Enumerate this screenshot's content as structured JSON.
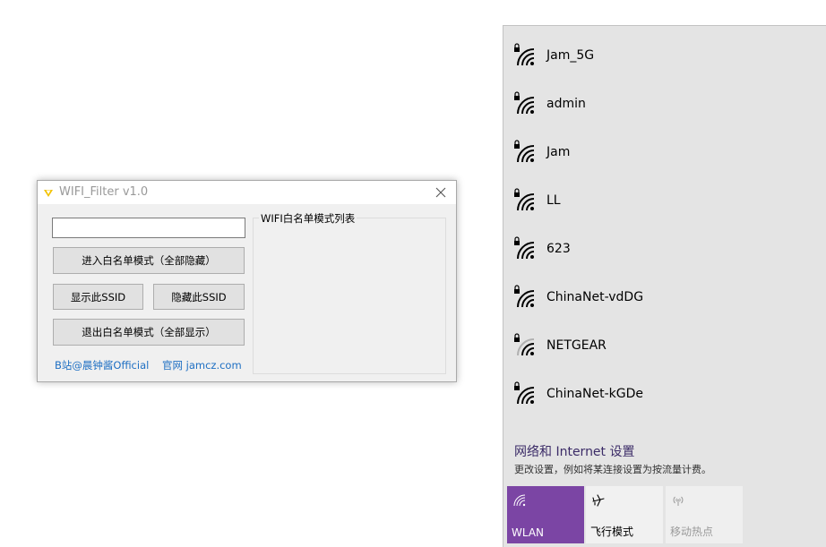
{
  "app": {
    "title": "WIFI_Filter v1.0",
    "input_value": "",
    "buttons": {
      "enter_whitelist": "进入白名单模式（全部隐藏）",
      "show_ssid": "显示此SSID",
      "hide_ssid": "隐藏此SSID",
      "exit_whitelist": "退出白名单模式（全部显示）"
    },
    "links": {
      "bilibili": "B站@晨钟酱Official",
      "website": "官网 jamcz.com"
    },
    "whitelist_group_label": "WIFI白名单模式列表"
  },
  "flyout": {
    "networks": [
      {
        "name": "Jam_5G",
        "secured": true,
        "signal": 4
      },
      {
        "name": "admin",
        "secured": true,
        "signal": 4
      },
      {
        "name": "Jam",
        "secured": true,
        "signal": 4
      },
      {
        "name": "LL",
        "secured": true,
        "signal": 4
      },
      {
        "name": "623",
        "secured": true,
        "signal": 3
      },
      {
        "name": "ChinaNet-vdDG",
        "secured": true,
        "signal": 3
      },
      {
        "name": "NETGEAR",
        "secured": true,
        "signal": 2
      },
      {
        "name": "ChinaNet-kGDe",
        "secured": true,
        "signal": 3
      }
    ],
    "settings": {
      "title": "网络和 Internet 设置",
      "description": "更改设置，例如将某连接设置为按流量计费。"
    },
    "tiles": {
      "wlan": "WLAN",
      "airplane": "飞行模式",
      "hotspot": "移动热点"
    },
    "colors": {
      "accent": "#7b45a4",
      "settings_link": "#3b2b67"
    }
  }
}
